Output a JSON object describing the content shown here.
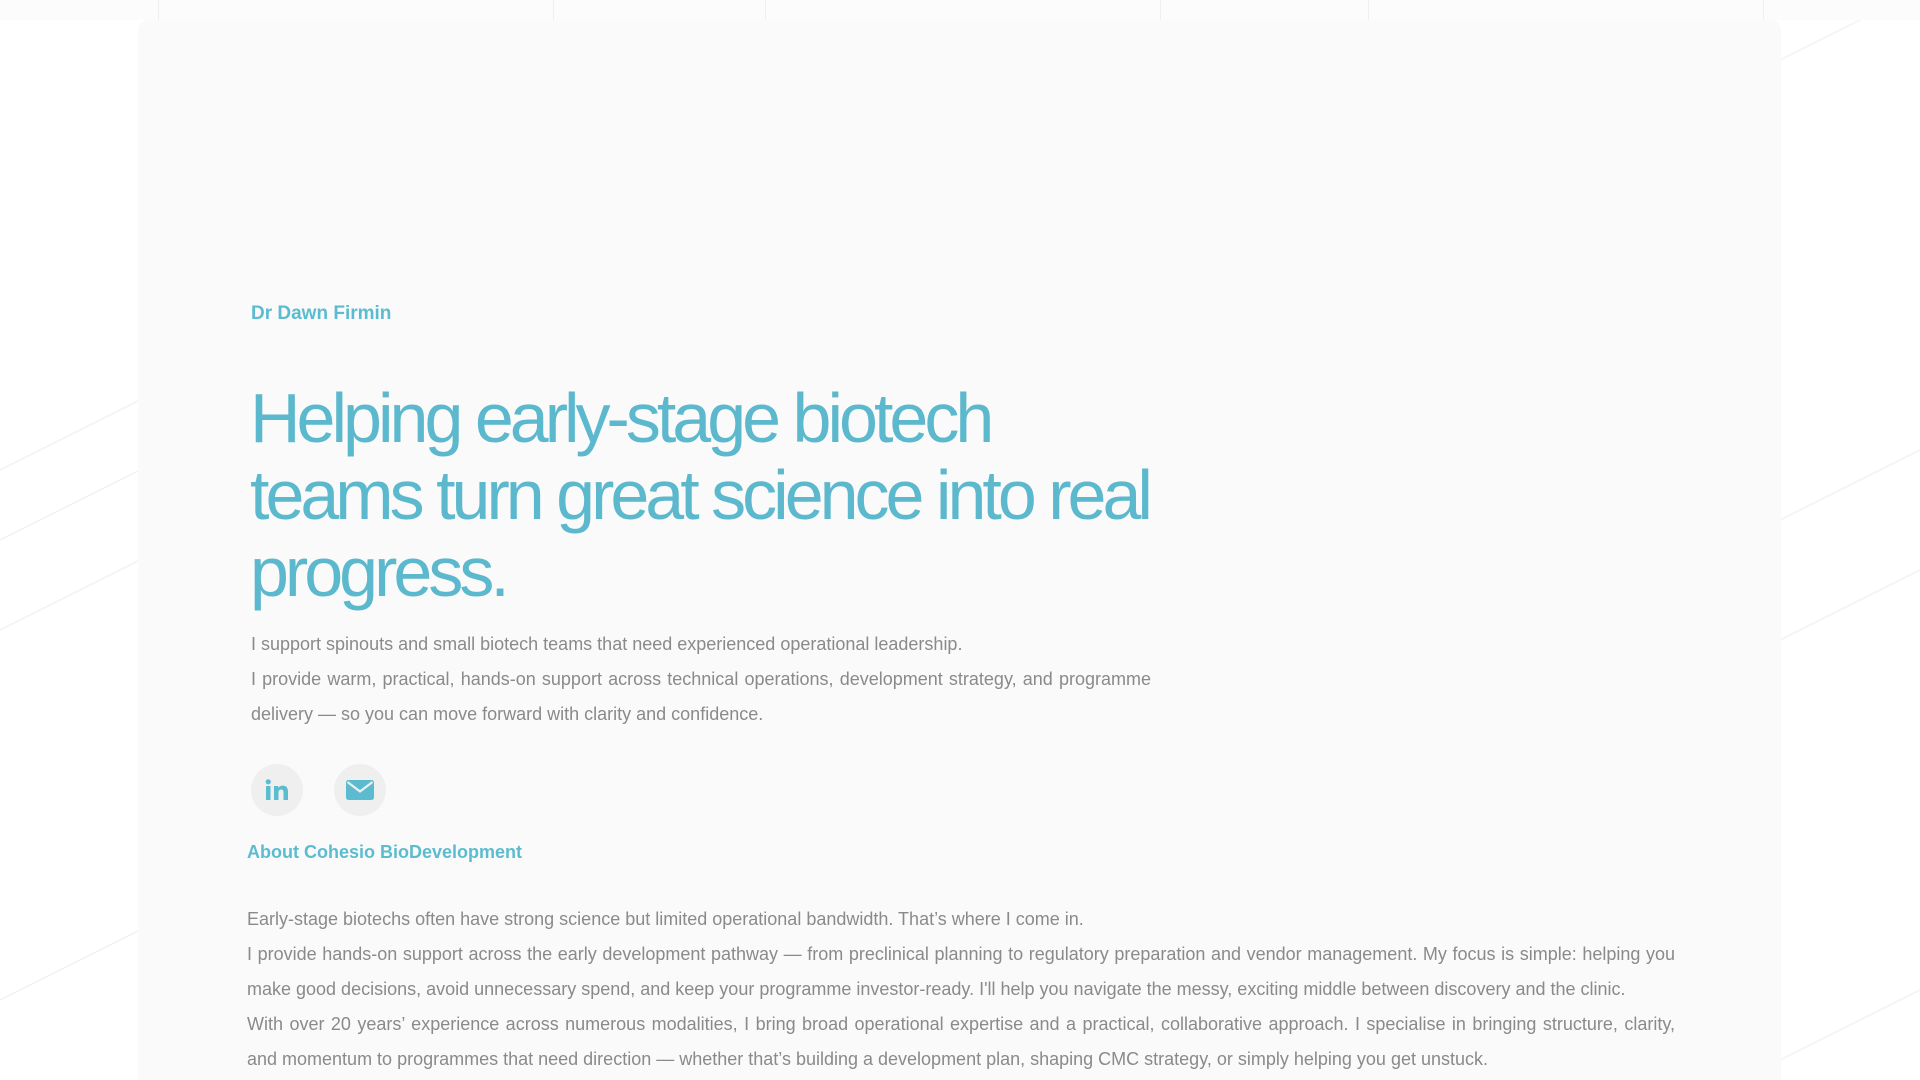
{
  "brand_color": "#5bbcd0",
  "hero": {
    "name": "Dr Dawn Firmin",
    "headline": "Helping early-stage biotech teams turn great science into real progress.",
    "intro": [
      "I support spinouts and small biotech teams that need experienced operational leadership.",
      "I provide warm, practical, hands-on support across technical operations, development strategy, and programme delivery — so you can move forward with clarity and confidence."
    ]
  },
  "social": {
    "linkedin_icon": "linkedin-icon",
    "email_icon": "email-icon"
  },
  "about": {
    "title": "About Cohesio BioDevelopment",
    "paragraphs": [
      "Early-stage biotechs often have strong science but limited operational bandwidth. That’s where I come in.",
      "I provide hands-on support across the early development pathway — from preclinical planning to regulatory preparation and vendor management. My focus is simple: helping you make good decisions, avoid unnecessary spend, and keep your programme investor-ready. I'll help you navigate the messy, exciting middle between discovery and the clinic.",
      "With over 20 years’ experience across numerous modalities, I bring broad operational expertise and a practical, collaborative approach. I specialise in bringing structure, clarity, and momentum to programmes that need direction — whether that’s building a development plan, shaping CMC strategy, or simply helping you get unstuck."
    ]
  }
}
